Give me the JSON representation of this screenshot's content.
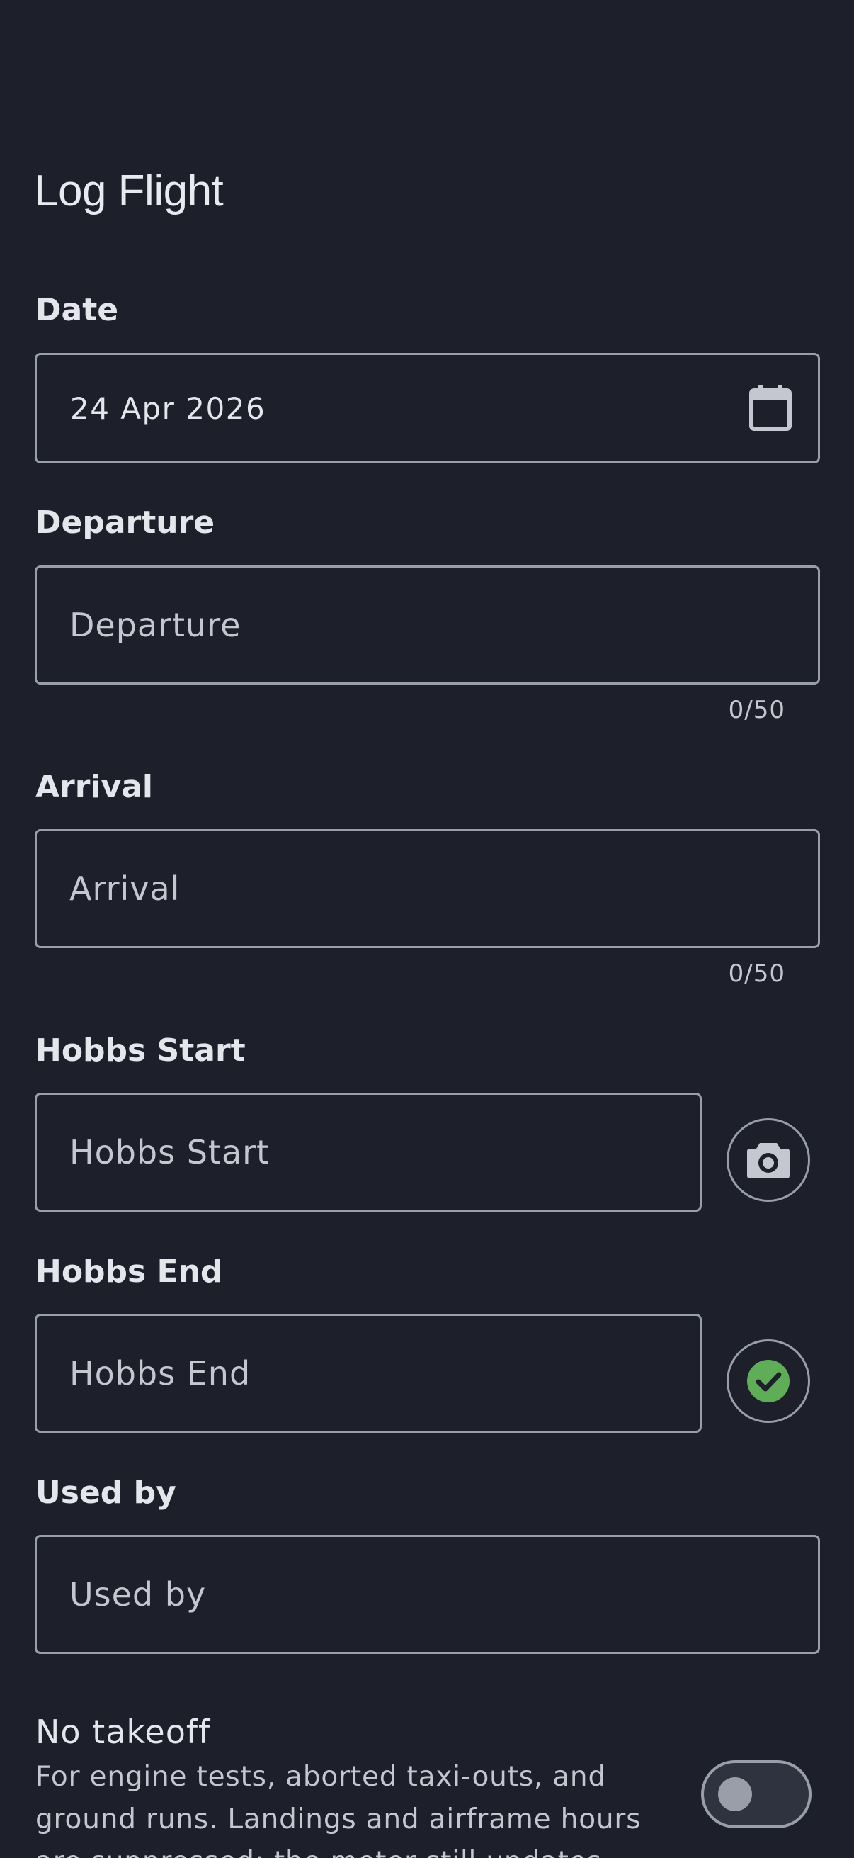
{
  "title": "Log Flight",
  "fields": {
    "date": {
      "label": "Date",
      "value": "24 Apr 2026"
    },
    "departure": {
      "label": "Departure",
      "placeholder": "Departure",
      "counter": "0/50"
    },
    "arrival": {
      "label": "Arrival",
      "placeholder": "Arrival",
      "counter": "0/50"
    },
    "hobbs_start": {
      "label": "Hobbs Start",
      "placeholder": "Hobbs Start"
    },
    "hobbs_end": {
      "label": "Hobbs End",
      "placeholder": "Hobbs End"
    },
    "used_by": {
      "label": "Used by",
      "placeholder": "Used by"
    }
  },
  "no_takeoff": {
    "title": "No takeoff",
    "description": "For engine tests, aborted taxi-outs, and ground runs. Landings and airframe hours are suppressed; the meter still updates.",
    "enabled": false
  },
  "icons": {
    "date": "calendar-icon",
    "hobbs_start": "camera-icon",
    "hobbs_end": "check-circle-icon"
  },
  "colors": {
    "background": "#1d202a",
    "border": "#9a9ea8",
    "success": "#5fae57"
  }
}
